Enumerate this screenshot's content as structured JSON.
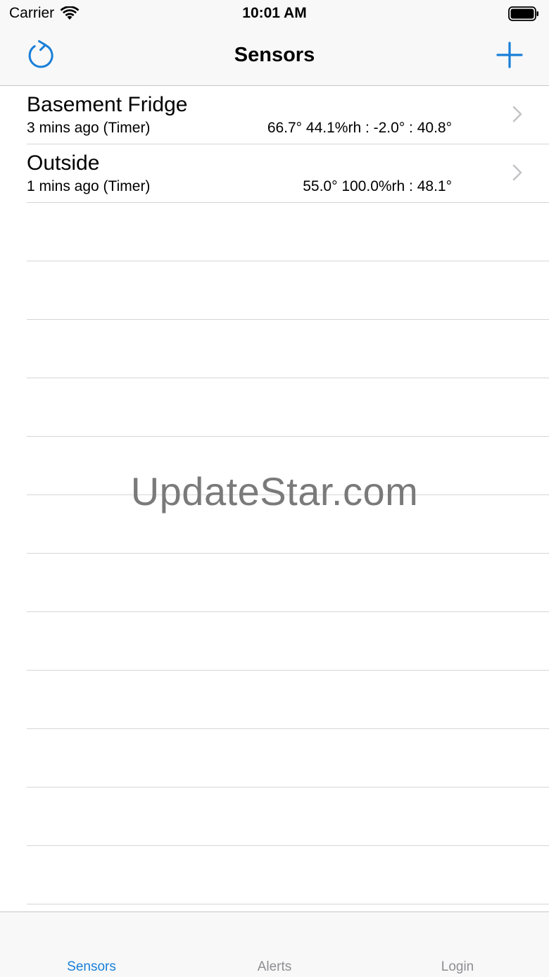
{
  "status_bar": {
    "carrier": "Carrier",
    "time": "10:01 AM"
  },
  "nav": {
    "title": "Sensors",
    "left_icon": "refresh-icon",
    "right_icon": "plus-icon"
  },
  "sensors": [
    {
      "name": "Basement Fridge",
      "updated": "3 mins ago (Timer)",
      "values": "66.7° 44.1%rh : -2.0° : 40.8°"
    },
    {
      "name": "Outside",
      "updated": "1 mins ago (Timer)",
      "values": "55.0° 100.0%rh : 48.1°"
    }
  ],
  "watermark": "UpdateStar.com",
  "tabs": [
    {
      "label": "Sensors",
      "active": true
    },
    {
      "label": "Alerts",
      "active": false
    },
    {
      "label": "Login",
      "active": false
    }
  ],
  "colors": {
    "accent": "#1a7fd8",
    "tab_inactive": "#8e8e93",
    "separator": "#d6d6da",
    "bar_background": "#f8f8f8"
  }
}
